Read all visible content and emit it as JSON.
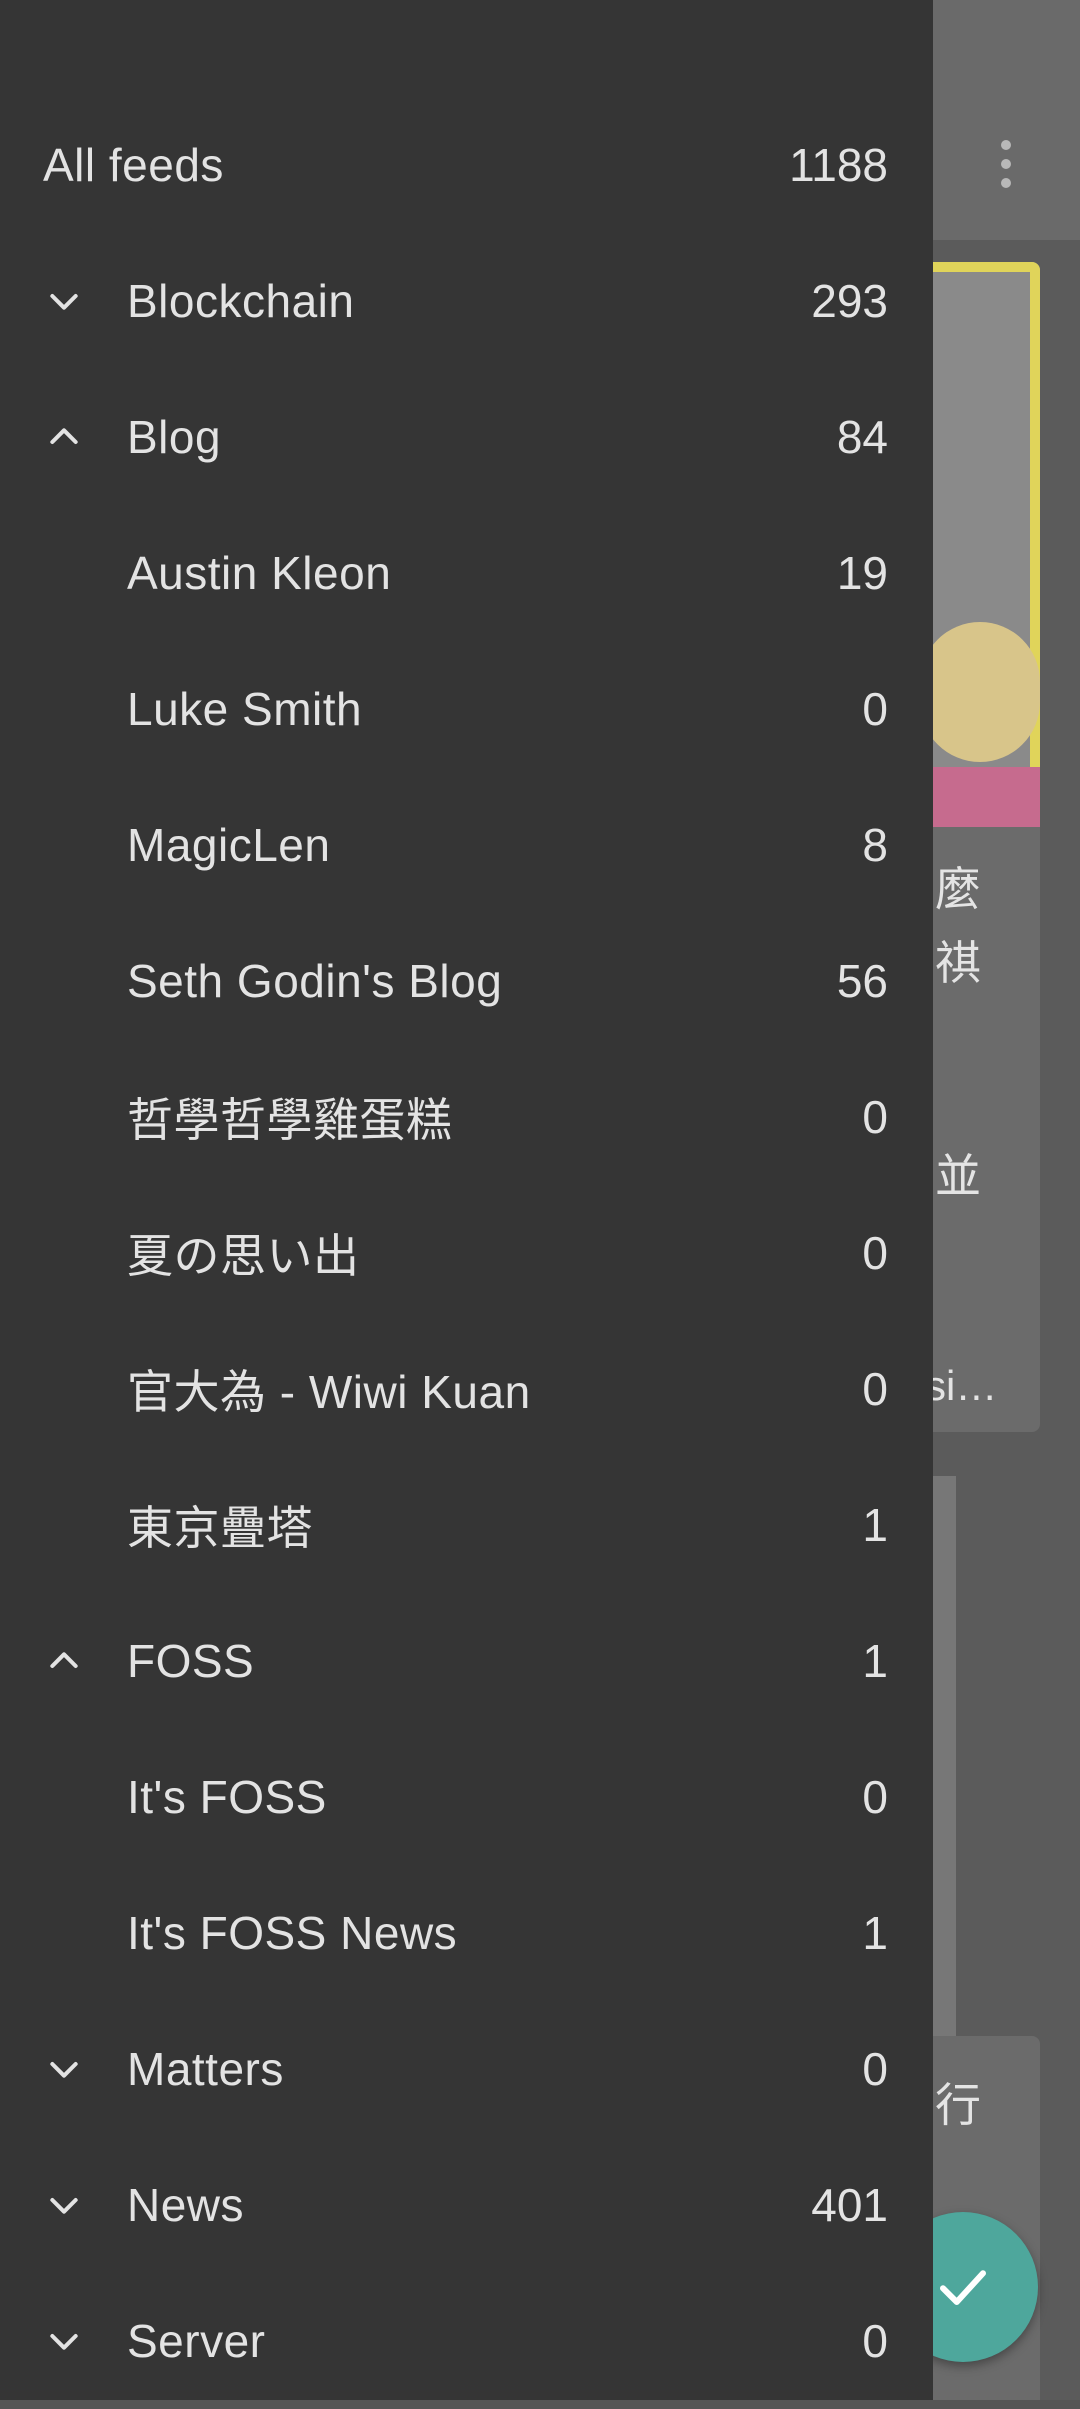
{
  "background": {
    "text_fragments": [
      "麼",
      "祺",
      "並",
      "si…",
      "行"
    ]
  },
  "drawer": {
    "items": [
      {
        "label": "All feeds",
        "count": "1188",
        "chevron": "none",
        "top": true
      },
      {
        "label": "Blockchain",
        "count": "293",
        "chevron": "down"
      },
      {
        "label": "Blog",
        "count": "84",
        "chevron": "up"
      },
      {
        "label": "Austin Kleon",
        "count": "19",
        "chevron": "none"
      },
      {
        "label": "Luke Smith",
        "count": "0",
        "chevron": "none"
      },
      {
        "label": "MagicLen",
        "count": "8",
        "chevron": "none"
      },
      {
        "label": "Seth Godin's Blog",
        "count": "56",
        "chevron": "none"
      },
      {
        "label": "哲學哲學雞蛋糕",
        "count": "0",
        "chevron": "none"
      },
      {
        "label": "夏の思い出",
        "count": "0",
        "chevron": "none"
      },
      {
        "label": "官大為 - Wiwi Kuan",
        "count": "0",
        "chevron": "none"
      },
      {
        "label": "東京疊塔",
        "count": "1",
        "chevron": "none"
      },
      {
        "label": "FOSS",
        "count": "1",
        "chevron": "up"
      },
      {
        "label": "It's FOSS",
        "count": "0",
        "chevron": "none"
      },
      {
        "label": "It's FOSS News",
        "count": "1",
        "chevron": "none"
      },
      {
        "label": "Matters",
        "count": "0",
        "chevron": "down"
      },
      {
        "label": "News",
        "count": "401",
        "chevron": "down"
      },
      {
        "label": "Server",
        "count": "0",
        "chevron": "down"
      }
    ]
  },
  "colors": {
    "drawer_bg": "#353535",
    "text": "#e3e3e3",
    "fab": "#4ea79c"
  },
  "icons": {
    "more": "more-vert-icon",
    "fab": "check-icon",
    "expand": "chevron-down-icon",
    "collapse": "chevron-up-icon"
  }
}
